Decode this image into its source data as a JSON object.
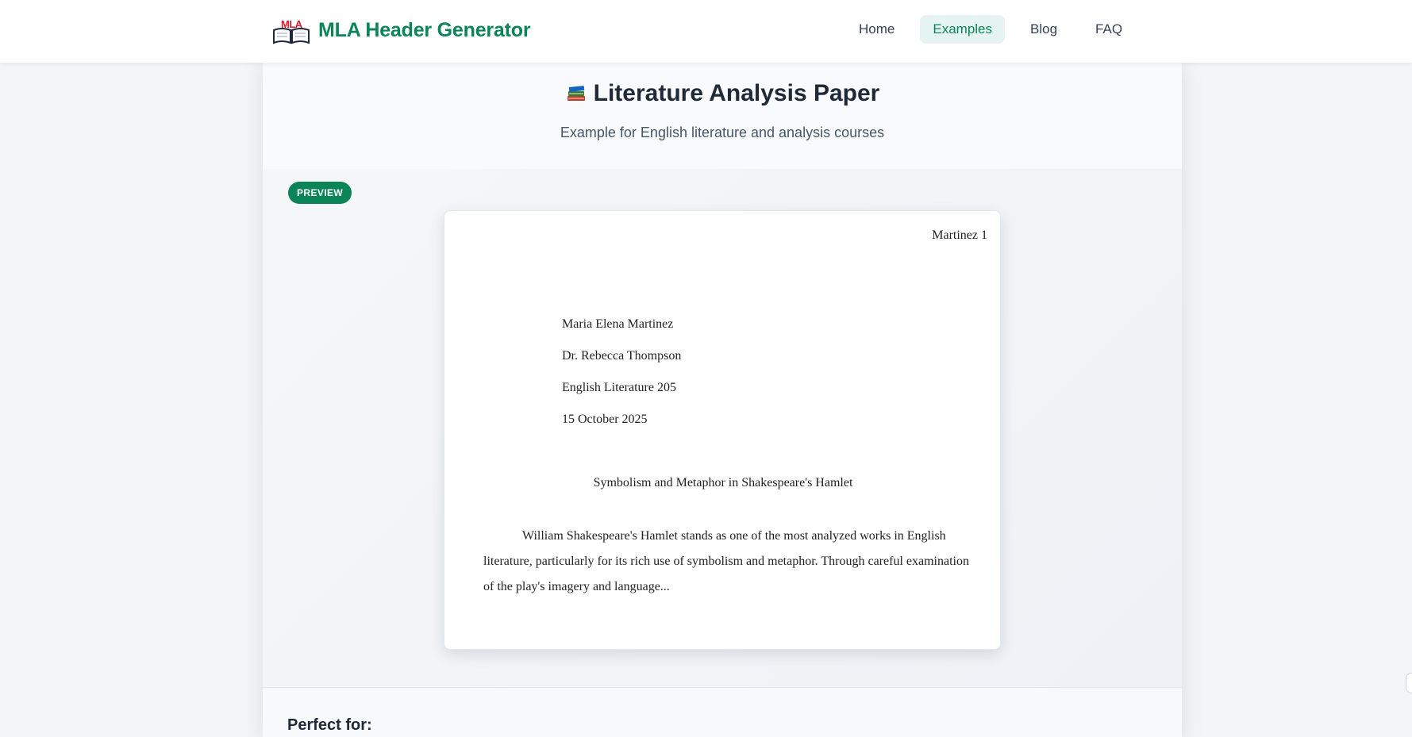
{
  "brand": {
    "logo_text": "MLA",
    "name": "MLA Header Generator"
  },
  "nav": {
    "items": [
      {
        "label": "Home",
        "active": false
      },
      {
        "label": "Examples",
        "active": true
      },
      {
        "label": "Blog",
        "active": false
      },
      {
        "label": "FAQ",
        "active": false
      }
    ]
  },
  "card": {
    "icon": "books-icon",
    "title": "Literature Analysis Paper",
    "subtitle": "Example for English literature and analysis courses",
    "badge": "PREVIEW"
  },
  "paper": {
    "running_head": "Martinez 1",
    "header_lines": [
      "Maria Elena Martinez",
      "Dr. Rebecca Thompson",
      "English Literature 205",
      "15 October 2025"
    ],
    "title": "Symbolism and Metaphor in Shakespeare's Hamlet",
    "body": "William Shakespeare's Hamlet stands as one of the most analyzed works in English literature, particularly for its rich use of symbolism and metaphor. Through careful examination of the play's imagery and language..."
  },
  "section": {
    "perfect_for_label": "Perfect for:"
  },
  "colors": {
    "brand": "#0b8457",
    "logo_red": "#d81b2a",
    "active_nav_bg": "#e6f4f1"
  }
}
